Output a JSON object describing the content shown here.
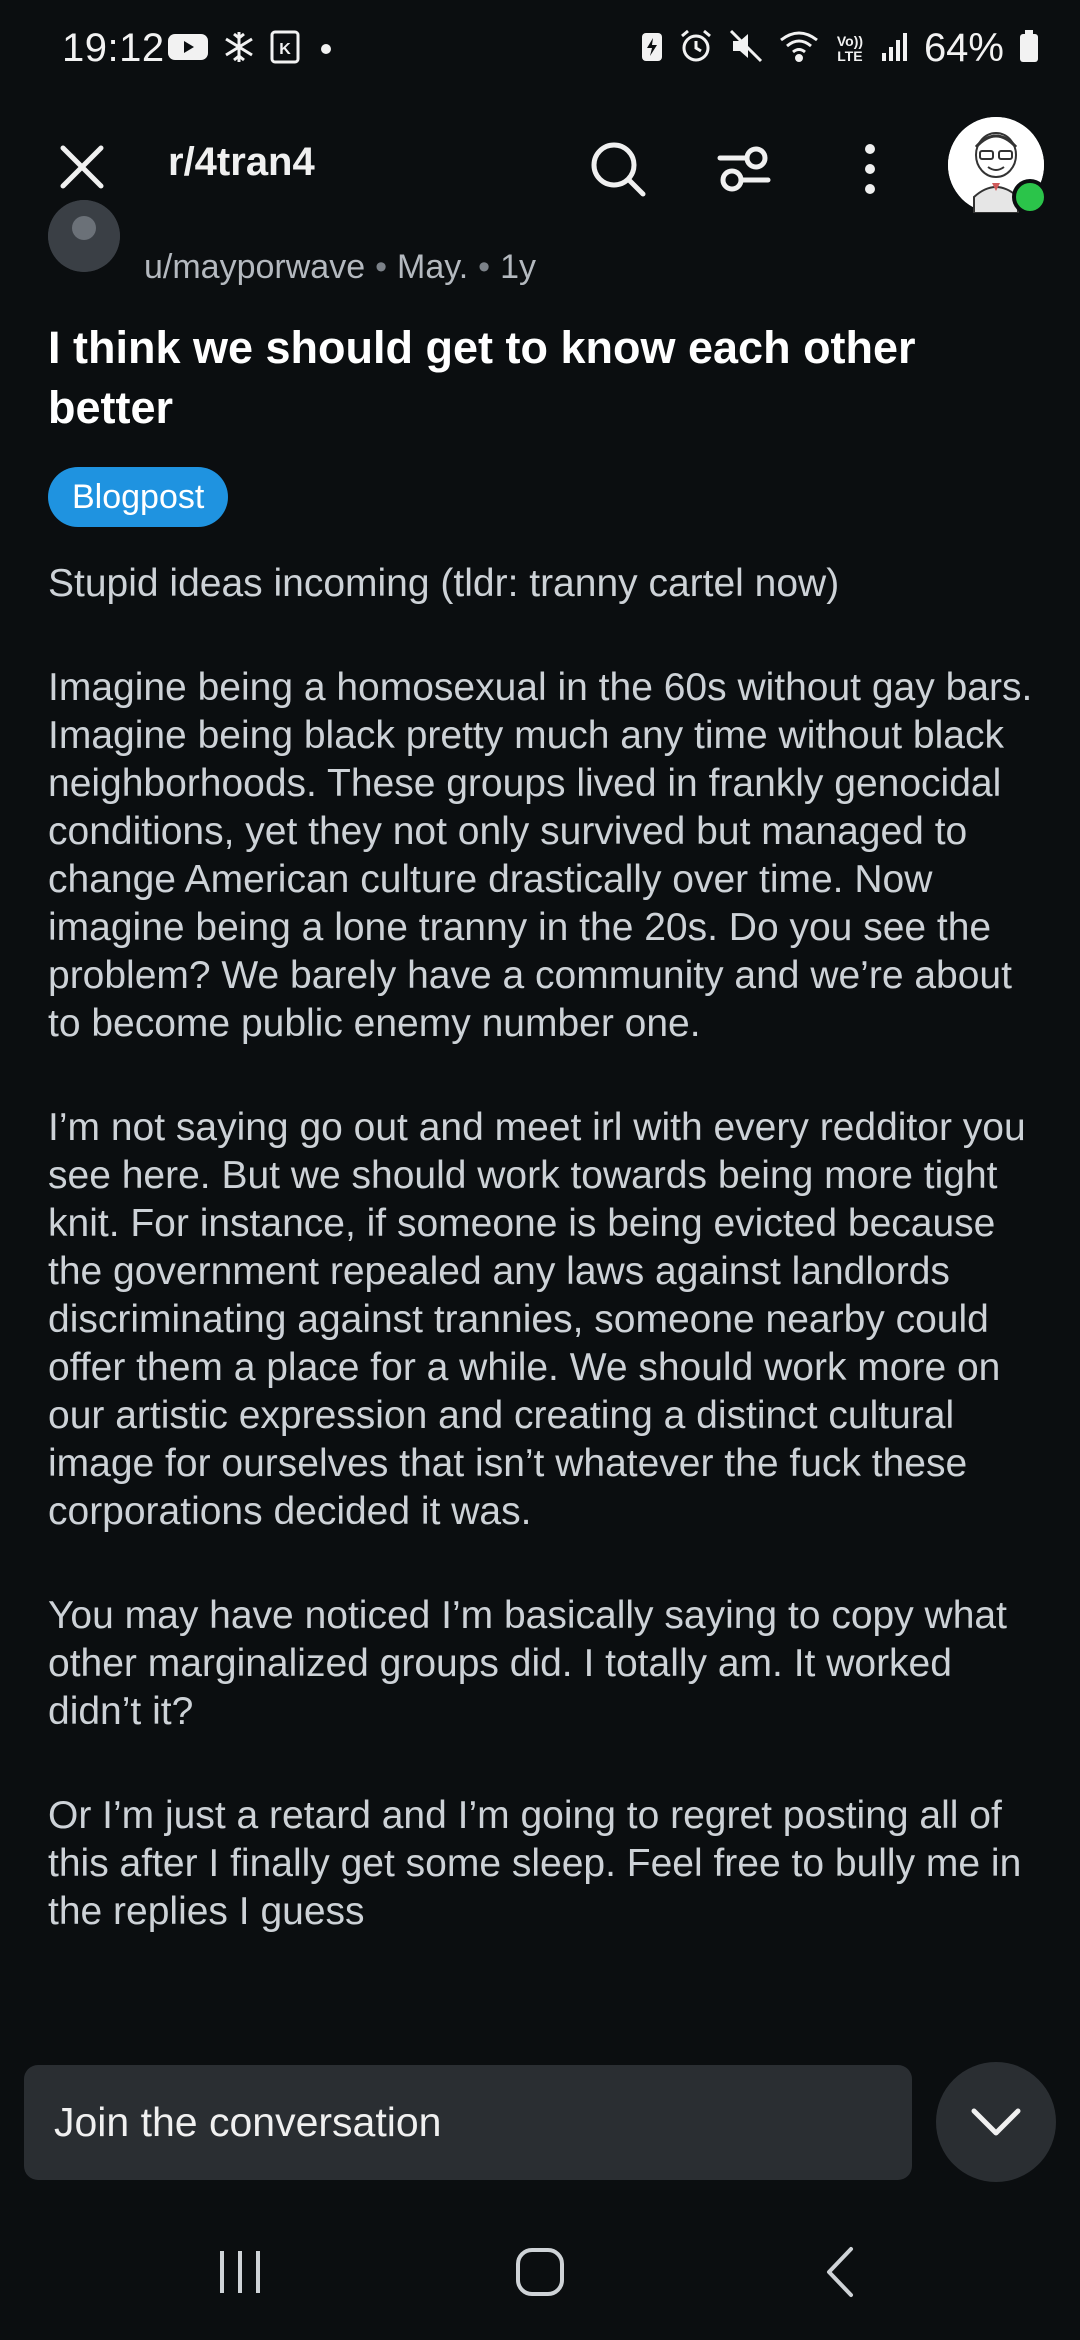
{
  "status_bar": {
    "time": "19:12",
    "battery_text": "64%",
    "network_label": "Vo)) LTE",
    "left_icons": [
      "youtube-icon",
      "snowflake-icon",
      "keyboard-icon",
      "dot-icon"
    ],
    "right_icons": [
      "battery-saver-icon",
      "alarm-icon",
      "mute-icon",
      "wifi-icon",
      "volte-icon",
      "signal-icon",
      "battery-icon"
    ]
  },
  "header": {
    "subreddit": "r/4tran4",
    "icons": [
      "close-icon",
      "search-icon",
      "filter-icon",
      "more-vertical-icon",
      "avatar"
    ]
  },
  "post": {
    "author": "u/mayporwave",
    "month": "May.",
    "age": "1y",
    "title": "I think we should get to know each other better",
    "flair": "Blogpost",
    "flair_color": "#1f93e0",
    "paragraphs": [
      "Stupid ideas incoming (tldr: tranny cartel now)",
      "Imagine being a homosexual in the 60s without gay bars. Imagine being black pretty much any time without black neighborhoods. These groups lived in frankly genocidal conditions, yet they not only survived but managed to change American culture drastically over time. Now imagine being a lone tranny in the 20s. Do you see the problem? We barely have a community and we’re about to become public enemy number one.",
      "I’m not saying go out and meet irl with every redditor you see here. But we should work towards being more tight knit. For instance, if someone is being evicted because the government repealed any laws against landlords discriminating against trannies, someone nearby could offer them a place for a while. We should work more on our artistic expression and creating a distinct cultural image for ourselves that isn’t whatever the fuck these corporations decided it was.",
      "You may have noticed I’m basically saying to copy what other marginalized groups did. I totally am. It worked didn’t it?",
      "Or I’m just a retard and I’m going to regret posting all of this after I finally get some sleep. Feel free to bully me in the replies I guess"
    ]
  },
  "composer": {
    "placeholder": "Join the conversation",
    "icon": "chevron-down-icon"
  },
  "nav_bar": {
    "icons": [
      "recents-icon",
      "home-icon",
      "back-icon"
    ]
  },
  "colors": {
    "background": "#0b0e10",
    "surface": "#2a2e32",
    "online": "#2bc44a"
  }
}
